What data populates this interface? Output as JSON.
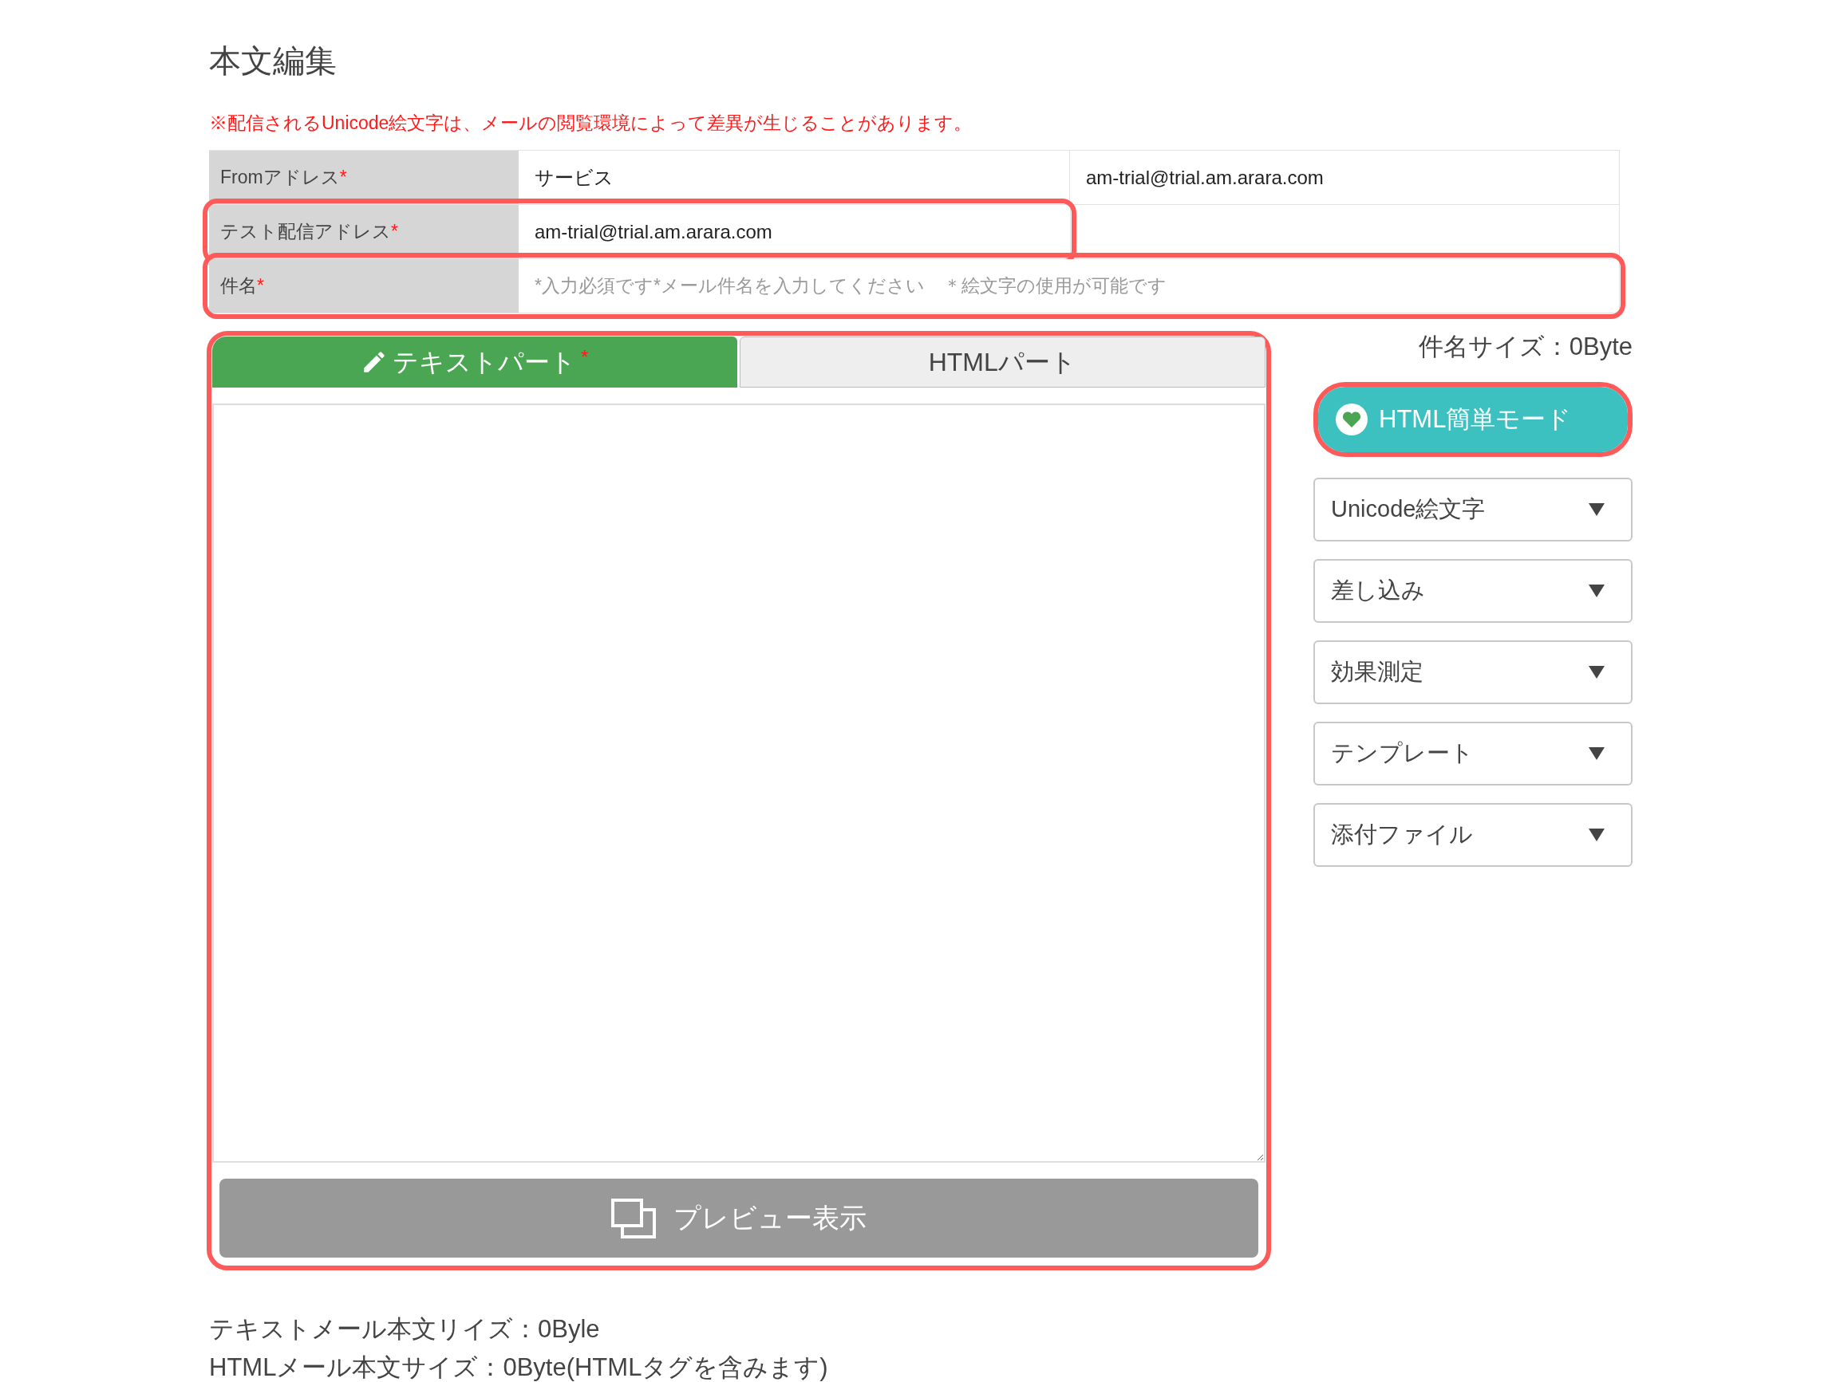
{
  "heading": "本文編集",
  "notice": "※配信されるUnicode絵文字は、メールの閲覧環境によって差異が生じることがあります。",
  "fields": [
    {
      "kind": "from",
      "label": "Fromアドレス",
      "mark": "*",
      "highlighted": false,
      "value": "サービス",
      "address": "am-trial@trial.am.arara.com"
    },
    {
      "kind": "address",
      "label": "テスト配信アドレス",
      "mark": "*",
      "highlighted": true,
      "value": "am-trial@trial.am.arara.com"
    },
    {
      "kind": "subject",
      "label": "件名",
      "mark": "*",
      "highlighted": true,
      "placeholder": "*入力必須です*メール件名を入力してください　＊絵文字の使用が可能です"
    }
  ],
  "subject_size": "件名サイズ：0Byte",
  "editor": {
    "highlighted": true,
    "tabs": [
      {
        "label": "テキストパート",
        "mark": "*",
        "selected": true
      },
      {
        "label": "HTMLパート",
        "selected": false
      }
    ],
    "preview_button": "プレビュー表示"
  },
  "mode_button": {
    "label": "HTML簡単モード",
    "highlighted": true
  },
  "menus": [
    "Unicode絵文字",
    "差し込み",
    "効果測定",
    "テンプレート",
    "添付ファイル"
  ],
  "sizes": [
    "テキストメール本文リイズ：0Byle",
    "HTMLメール本文サイズ：0Byte(HTMLタグを含みます)"
  ]
}
